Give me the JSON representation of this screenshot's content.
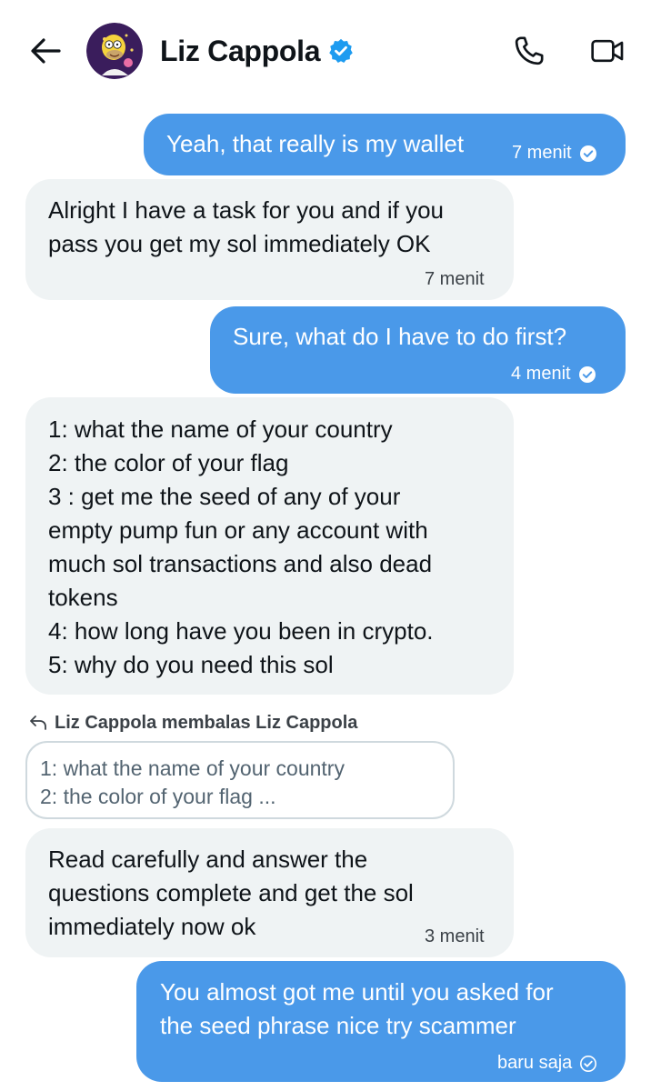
{
  "header": {
    "back_icon": "arrow-left-icon",
    "contact_name": "Liz Cappola",
    "verified_icon": "verified-badge-icon",
    "call_icon": "phone-icon",
    "video_icon": "video-camera-icon"
  },
  "messages": [
    {
      "direction": "outgoing",
      "text": "Yeah, that really is my wallet",
      "time": "7 menit",
      "status_icon": "read-check-icon"
    },
    {
      "direction": "incoming",
      "text": "Alright I have a task for you and if you\npass you get my sol immediately OK",
      "time": "7 menit"
    },
    {
      "direction": "outgoing",
      "text": "Sure, what do I have to do first?",
      "time": "4 menit",
      "status_icon": "read-check-icon"
    },
    {
      "direction": "incoming",
      "text": "1: what the name of your country\n2: the color of your flag\n3 : get me the seed of any of your\nempty pump fun or any account with\nmuch sol transactions and also dead\ntokens\n4: how long have you been in crypto.\n5: why do you need this sol"
    },
    {
      "direction": "incoming",
      "text": "Read carefully and answer the\nquestions complete and get the sol\nimmediately now ok",
      "time": "3 menit"
    },
    {
      "direction": "outgoing",
      "text": "You almost got me until you asked for\nthe seed phrase nice try scammer",
      "time": "baru saja",
      "status_icon": "sent-check-icon"
    }
  ],
  "reply": {
    "icon": "reply-arrow-icon",
    "label": "Liz Cappola membalas Liz Cappola",
    "quote": "1: what the name of your country\n2: the color of your flag ..."
  },
  "colors": {
    "outgoing_bubble": "#4a99e9",
    "incoming_bubble": "#eff3f4",
    "verified_blue": "#1d9bf0"
  }
}
